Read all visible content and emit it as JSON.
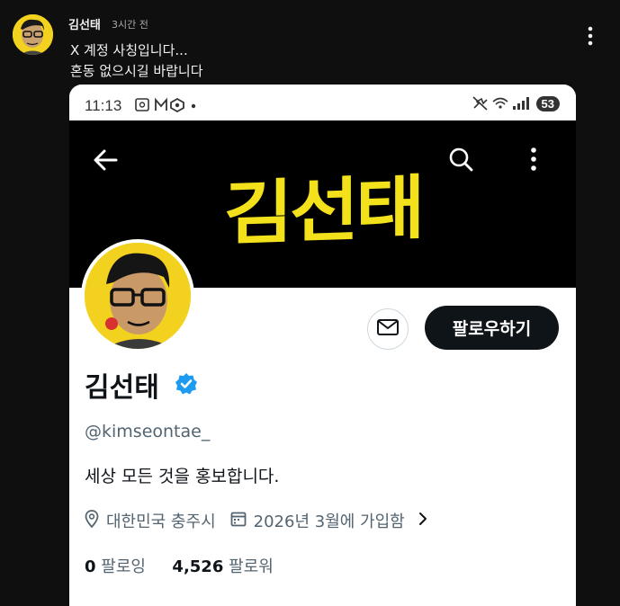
{
  "post": {
    "author": "김선태",
    "time": "3시간 전",
    "lines": [
      "X 계정 사칭입니다...",
      "혼동 없으시길 바랍니다"
    ]
  },
  "statusbar": {
    "time": "11:13",
    "battery": "53"
  },
  "profile": {
    "banner_text": "김선태",
    "name": "김선태",
    "handle": "@kimseontae_",
    "bio": "세상 모든 것을 홍보합니다.",
    "location": "대한민국 충주시",
    "joined": "2026년 3월에 가입함",
    "following_count": "0",
    "following_label": "팔로잉",
    "followers_count": "4,526",
    "followers_label": "팔로워",
    "follow_label": "팔로우하기"
  },
  "colors": {
    "banner_yellow": "#f3e11b",
    "avatar_bg": "#f2d21e",
    "verified_blue": "#1d9bf0",
    "follow_button": "#0f1419"
  },
  "icons": [
    "kebab-icon",
    "back-arrow-icon",
    "search-icon",
    "more-vertical-icon",
    "mail-icon",
    "verified-badge-icon",
    "location-pin-icon",
    "calendar-icon",
    "chevron-right-icon"
  ]
}
